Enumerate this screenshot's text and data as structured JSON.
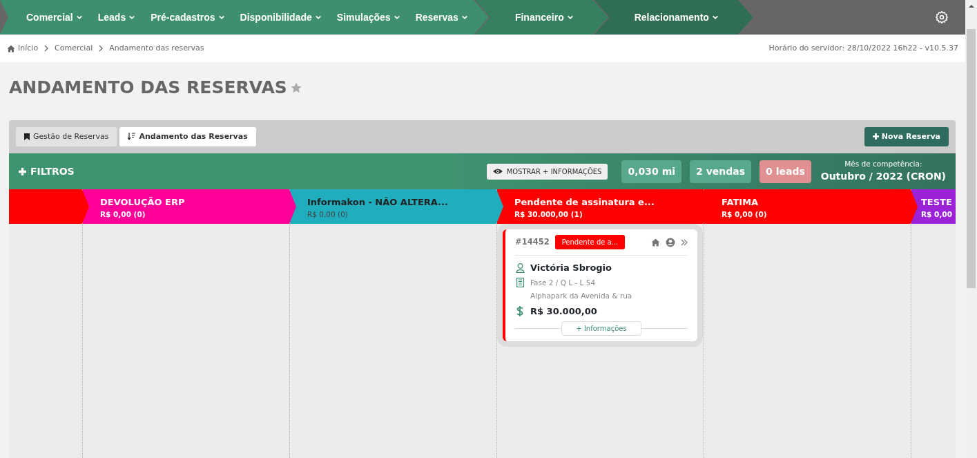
{
  "nav": {
    "segments": [
      {
        "color": "#3e8f6d",
        "items": [
          "Comercial",
          "Leads",
          "Pré-cadastros",
          "Disponibilidade",
          "Simulações",
          "Reservas"
        ]
      },
      {
        "color": "#368060",
        "items": [
          "Financeiro"
        ]
      },
      {
        "color": "#2f6e55",
        "items": [
          "Relacionamento"
        ]
      }
    ]
  },
  "breadcrumb": [
    "Início",
    "Comercial",
    "Andamento das reservas"
  ],
  "server_time": "Horário do servidor: 28/10/2022 16h22 - v10.5.37",
  "page_title": "ANDAMENTO DAS RESERVAS",
  "tabs": [
    {
      "label": "Gestão de Reservas",
      "selected": false
    },
    {
      "label": "Andamento das Reservas",
      "selected": true
    }
  ],
  "new_button": "Nova Reserva",
  "filters": {
    "label": "FILTROS",
    "show_more": "MOSTRAR + INFORMAÇÕES",
    "stats": [
      {
        "text": "0,030 mi",
        "color": "#58a88c"
      },
      {
        "text": "2 vendas",
        "color": "#58a88c"
      },
      {
        "text": "0 leads",
        "color": "#e09090"
      }
    ],
    "month_label": "Mês de competência:",
    "month": "Outubro / 2022 (CRON)"
  },
  "columns": [
    {
      "color": "#ff0000"
    },
    {
      "name": "DEVOLUÇÃO ERP",
      "total": "R$ 0,00 (0)",
      "color": "#ff0099"
    },
    {
      "name": "Informakon - NÂO ALTERA...",
      "total": "R$ 0,00 (0)",
      "color": "#20adbd",
      "dark_text": true
    },
    {
      "name": "Pendente de assinatura e...",
      "total": "R$ 30.000,00 (1)",
      "color": "#ff0000",
      "cards": [
        {
          "id": "#14452",
          "status": "Pendente de a...",
          "client": "Victória Sbrogio",
          "unit": "Fase 2 / Q L - L 54",
          "project": "Alphapark da Avenida & rua",
          "value": "R$ 30.000,00",
          "more": "+ Informações"
        }
      ]
    },
    {
      "name": "FATIMA",
      "total": "R$ 0,00 (0)",
      "color": "#ff0000"
    },
    {
      "name": "TESTE",
      "total": "R$ 0,00",
      "color": "#9b22d6"
    }
  ]
}
